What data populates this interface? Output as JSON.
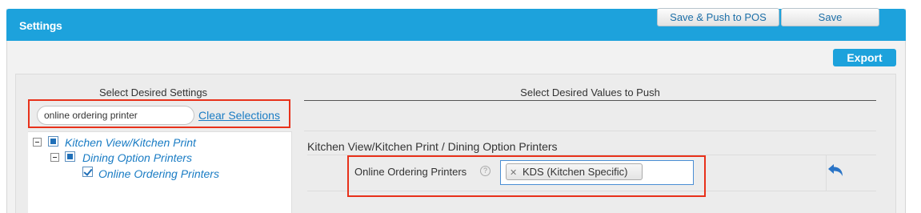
{
  "header": {
    "title": "Settings",
    "save_push_label": "Save & Push to POS",
    "save_label": "Save"
  },
  "toolbar": {
    "export_label": "Export"
  },
  "left_panel": {
    "title": "Select Desired Settings",
    "search": {
      "value": "online ordering printer"
    },
    "clear_label": "Clear Selections",
    "tree": [
      {
        "label": "Kitchen View/Kitchen Print",
        "state": "partial"
      },
      {
        "label": "Dining Option Printers",
        "state": "partial"
      },
      {
        "label": "Online Ordering Printers",
        "state": "checked"
      }
    ]
  },
  "right_panel": {
    "title": "Select Desired Values to Push",
    "section_title": "Kitchen View/Kitchen Print / Dining Option Printers",
    "field": {
      "label": "Online Ordering Printers",
      "help_glyph": "?",
      "selected_tag": "KDS (Kitchen Specific)",
      "remove_glyph": "✕"
    }
  },
  "colors": {
    "header_blue": "#1da2dc",
    "link_blue": "#1a7cc4",
    "highlight_red": "#e8311a"
  },
  "icons": {
    "undo": "undo-arrow-icon"
  }
}
